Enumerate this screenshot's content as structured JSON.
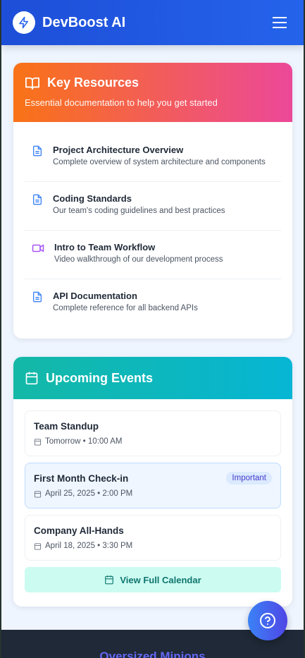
{
  "header": {
    "brand": "DevBoost AI"
  },
  "resources": {
    "title": "Key Resources",
    "subtitle": "Essential documentation to help you get started",
    "items": [
      {
        "title": "Project Architecture Overview",
        "desc": "Complete overview of system architecture and components",
        "icon": "file-icon"
      },
      {
        "title": "Coding Standards",
        "desc": "Our team's coding guidelines and best practices",
        "icon": "file-icon"
      },
      {
        "title": "Intro to Team Workflow",
        "desc": "Video walkthrough of our development process",
        "icon": "video-icon"
      },
      {
        "title": "API Documentation",
        "desc": "Complete reference for all backend APIs",
        "icon": "file-icon"
      }
    ]
  },
  "events": {
    "title": "Upcoming Events",
    "items": [
      {
        "title": "Team Standup",
        "when": "Tomorrow • 10:00 AM"
      },
      {
        "title": "First Month Check-in",
        "when": "April 25, 2025 • 2:00 PM",
        "badge": "Important"
      },
      {
        "title": "Company All-Hands",
        "when": "April 18, 2025 • 3:30 PM"
      }
    ],
    "button": "View Full Calendar"
  },
  "footer": {
    "title": "Oversized Minions"
  },
  "colors": {
    "header": "#2563eb",
    "resources_gradient": [
      "#f97316",
      "#ec4899"
    ],
    "events_gradient": [
      "#14b8a6",
      "#06b6d4"
    ]
  }
}
